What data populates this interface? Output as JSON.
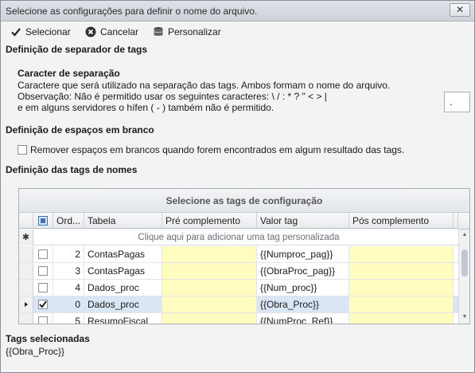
{
  "window": {
    "title": "Selecione as configurações para definir o nome do arquivo.",
    "close_glyph": "✕"
  },
  "toolbar": {
    "select_label": "Selecionar",
    "cancel_label": "Cancelar",
    "personalize_label": "Personalizar"
  },
  "separator_section": {
    "heading": "Definição de separador de tags",
    "subheading": "Caracter de separação",
    "line1": "Caractere que será utilizado na separação das tags. Ambos formam o nome do arquivo.",
    "line2": "Observação: Não é permitido usar os seguintes caracteres: \\ / : * ? \" < > |",
    "line3": "e em alguns servidores o hífen ( - ) também não é permitido.",
    "value": "."
  },
  "whitespace_section": {
    "heading": "Definição de espaços em branco",
    "checkbox_label": "Remover espaços em brancos quando forem encontrados em algum resultado das tags.",
    "checked": false
  },
  "tags_section": {
    "heading": "Definição das tags de nomes",
    "grid_caption": "Selecione as tags de configuração",
    "columns": [
      "Ord...",
      "Tabela",
      "Pré complemento",
      "Valor tag",
      "Pós complemento"
    ],
    "new_row_hint": "Clique aqui para adicionar uma tag personalizada",
    "new_row_glyph": "✱",
    "rows": [
      {
        "ord": "2",
        "tabela": "ContasPagas",
        "pre": "",
        "valor": "{{Numproc_pag}}",
        "pos": "",
        "checked": false,
        "current": false
      },
      {
        "ord": "3",
        "tabela": "ContasPagas",
        "pre": "",
        "valor": "{{ObraProc_pag}}",
        "pos": "",
        "checked": false,
        "current": false
      },
      {
        "ord": "4",
        "tabela": "Dados_proc",
        "pre": "",
        "valor": "{{Num_proc}}",
        "pos": "",
        "checked": false,
        "current": false
      },
      {
        "ord": "0",
        "tabela": "Dados_proc",
        "pre": "",
        "valor": "{{Obra_Proc}}",
        "pos": "",
        "checked": true,
        "current": true
      },
      {
        "ord": "5",
        "tabela": "ResumoFiscal",
        "pre": "",
        "valor": "{{NumProc_Ref}}",
        "pos": "",
        "checked": false,
        "current": false
      }
    ]
  },
  "selected_section": {
    "heading": "Tags selecionadas",
    "value": "{{Obra_Proc}}"
  },
  "colors": {
    "highlight_yellow": "#fefdbf",
    "selected_row": "#dbe6f5"
  }
}
